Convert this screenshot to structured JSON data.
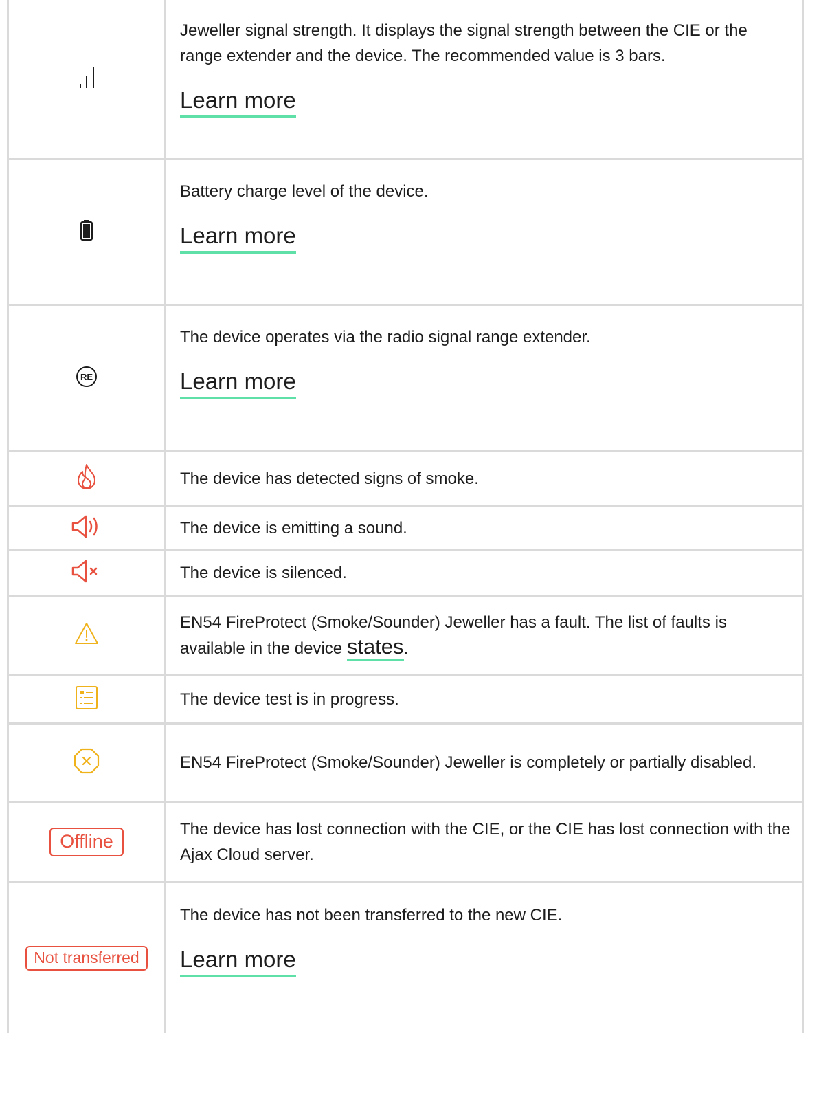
{
  "colors": {
    "red": "#e8513f",
    "amber": "#f0b21a",
    "link_underline": "#5ee0a8",
    "border": "#dadada"
  },
  "rows": [
    {
      "icon": "signal-strength-icon",
      "description": "Jeweller signal strength. It displays the signal strength between the CIE or the range extender and the device. The recommended value is 3 bars.",
      "link": "Learn more"
    },
    {
      "icon": "battery-icon",
      "description": "Battery charge level of the device.",
      "link": "Learn more"
    },
    {
      "icon": "range-extender-icon",
      "icon_text": "RE",
      "description": "The device operates via the radio signal range extender.",
      "link": "Learn more"
    },
    {
      "icon": "fire-icon",
      "description": "The device has detected signs of smoke."
    },
    {
      "icon": "speaker-sound-icon",
      "description": "The device is emitting a sound."
    },
    {
      "icon": "speaker-muted-icon",
      "description": "The device is silenced."
    },
    {
      "icon": "warning-triangle-icon",
      "description_before": "EN54 FireProtect (Smoke/Sounder) Jeweller has a fault. The list of faults is available in the device ",
      "inline_link": "states",
      "description_after": "."
    },
    {
      "icon": "device-test-icon",
      "description": "The device test is in progress."
    },
    {
      "icon": "disabled-octagon-icon",
      "description": "EN54 FireProtect (Smoke/Sounder) Jeweller is completely or partially disabled."
    },
    {
      "icon": "offline-badge",
      "badge": "Offline",
      "description": "The device has lost connection with the CIE, or the CIE has lost connection with the Ajax Cloud server."
    },
    {
      "icon": "not-transferred-badge",
      "badge": "Not transferred",
      "description": "The device has not been transferred to the new CIE.",
      "link": "Learn more"
    }
  ]
}
